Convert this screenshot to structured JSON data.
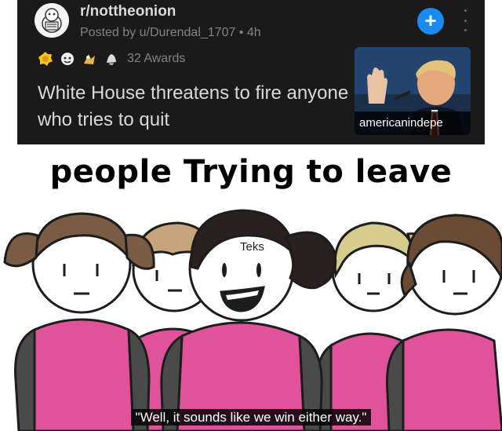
{
  "post": {
    "subreddit": "r/nottheonion",
    "posted_by": "Posted by u/Durendal_1707 • 4h",
    "awards_count": "32 Awards",
    "title": "White House threatens to fire anyone who tries to quit",
    "thumbnail_domain": "americanindepe",
    "join_label": "+",
    "icons": [
      "subreddit-avatar-icon",
      "award-icon",
      "more-options-icon"
    ]
  },
  "meme": {
    "caption": "people Trying to leave",
    "watermark": "Teks",
    "subtitle": "\"Well, it sounds like we win either way.\""
  },
  "colors": {
    "card_bg": "#1a1a1b",
    "join_blue": "#1a8cf0",
    "shirt_pink": "#e0529a",
    "sleeve_gray": "#4a4a4a"
  }
}
